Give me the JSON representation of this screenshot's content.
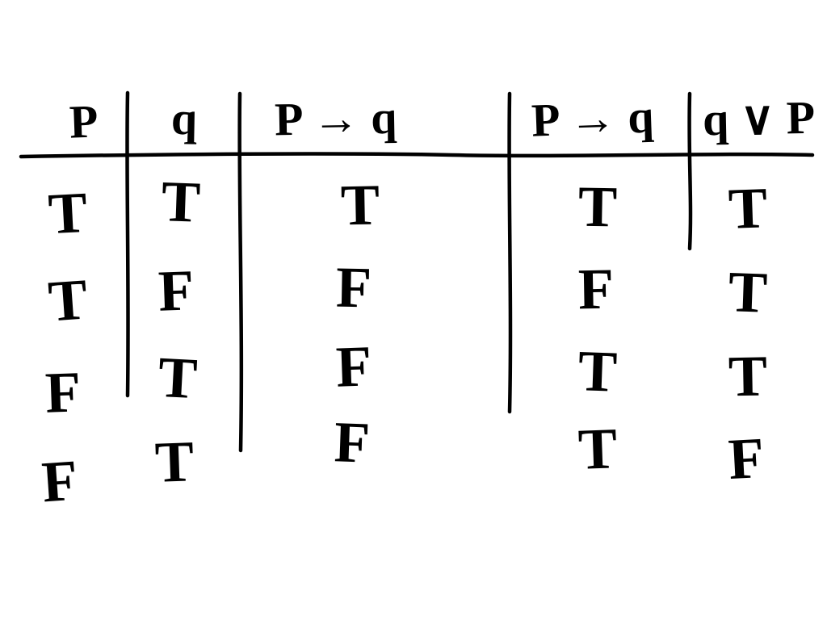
{
  "chart_data": {
    "type": "table",
    "title": "",
    "columns": [
      "P",
      "q",
      "P → q",
      "P → q",
      "q ∨ P"
    ],
    "rows": [
      [
        "T",
        "T",
        "T",
        "T",
        "T"
      ],
      [
        "T",
        "F",
        "F",
        "F",
        "T"
      ],
      [
        "F",
        "T",
        "F",
        "T",
        "T"
      ],
      [
        "F",
        "T",
        "F",
        "T",
        "F"
      ]
    ]
  },
  "headers": {
    "c0": "P",
    "c1": "q",
    "c2": "P → q",
    "c3": "P → q",
    "c4": "q ∨ P"
  },
  "cells": {
    "r0c0": "T",
    "r0c1": "T",
    "r0c2": "T",
    "r0c3": "T",
    "r0c4": "T",
    "r1c0": "T",
    "r1c1": "F",
    "r1c2": "F",
    "r1c3": "F",
    "r1c4": "T",
    "r2c0": "F",
    "r2c1": "T",
    "r2c2": "F",
    "r2c3": "T",
    "r2c4": "T",
    "r3c0": "F",
    "r3c1": "T",
    "r3c2": "F",
    "r3c3": "T",
    "r3c4": "F"
  }
}
